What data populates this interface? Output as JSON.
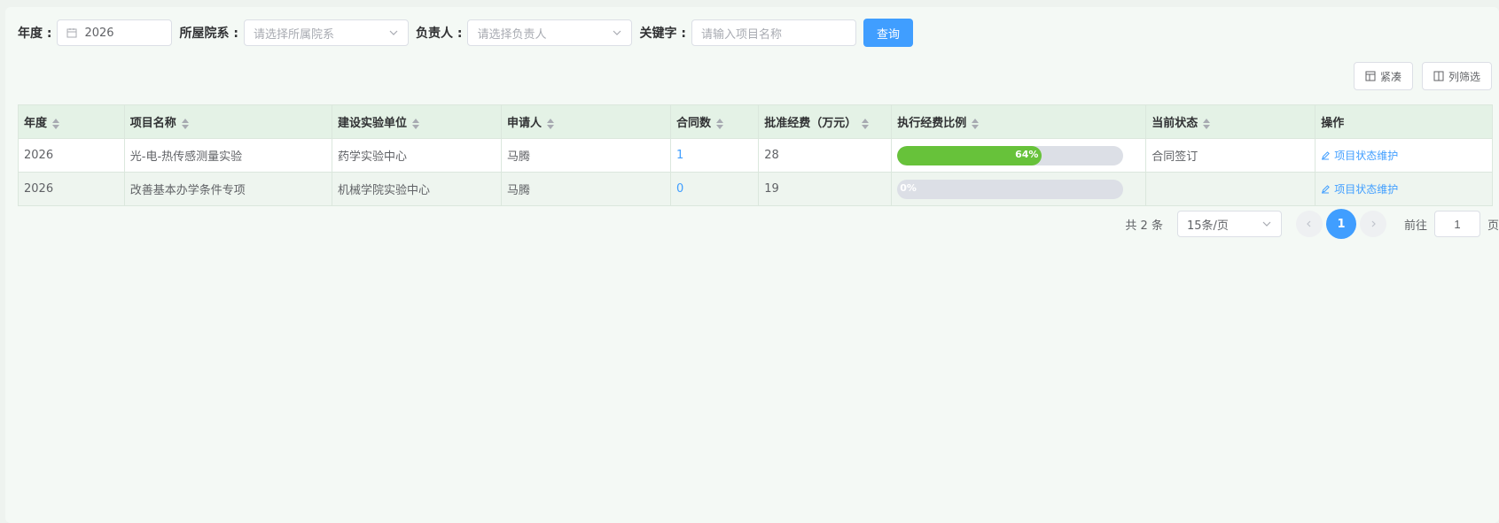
{
  "filters": {
    "year_label": "年度 :",
    "year_value": "2026",
    "dept_label": "所屋院系 :",
    "dept_placeholder": "请选择所属院系",
    "owner_label": "负责人 :",
    "owner_placeholder": "请选择负责人",
    "keyword_label": "关键字 :",
    "keyword_placeholder": "请输入项目名称",
    "search_button": "查询"
  },
  "toolbar": {
    "compact_label": "紧凑",
    "columns_label": "列筛选"
  },
  "table": {
    "headers": [
      "年度",
      "项目名称",
      "建设实验单位",
      "申请人",
      "合同数",
      "批准经费（万元）",
      "执行经费比例",
      "当前状态",
      "操作"
    ],
    "rows": [
      {
        "year": "2026",
        "name": "光-电-热传感测量实验",
        "unit": "药学实验中心",
        "applicant": "马腾",
        "contracts": "1",
        "funding": "28",
        "ratio": 0.64,
        "ratio_text": "64%",
        "status": "合同签订",
        "action": "项目状态维护"
      },
      {
        "year": "2026",
        "name": "改善基本办学条件专项",
        "unit": "机械学院实验中心",
        "applicant": "马腾",
        "contracts": "0",
        "funding": "19",
        "ratio": 0,
        "ratio_text": "0%",
        "status": "",
        "action": "项目状态维护"
      }
    ]
  },
  "pagination": {
    "total_text": "共 2 条",
    "page_size": "15条/页",
    "current_page": "1",
    "goto_label": "前往",
    "goto_value": "1",
    "page_suffix": "页"
  },
  "colors": {
    "primary": "#409eff",
    "progress": "#67c23a",
    "header_bg": "#e4f2e6"
  }
}
